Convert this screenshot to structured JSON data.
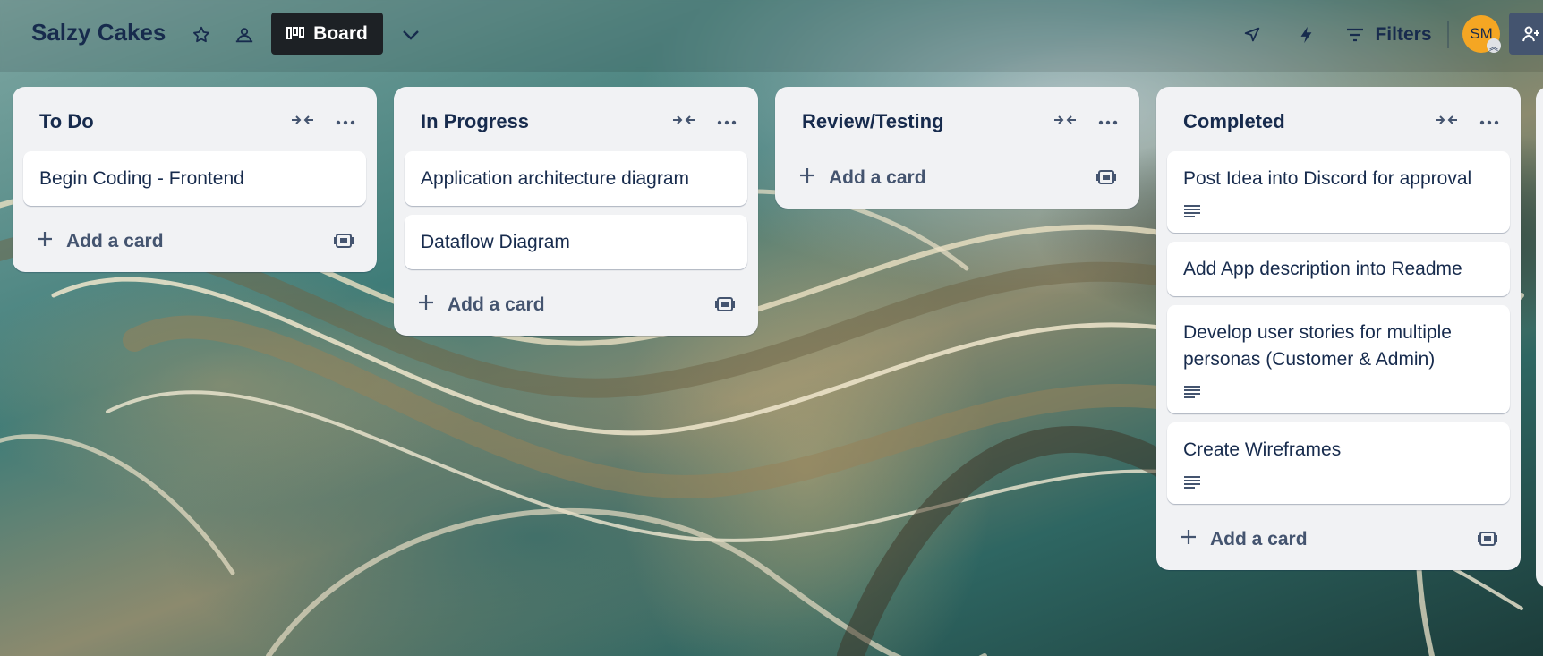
{
  "header": {
    "board_title": "Salzy Cakes",
    "view_label": "Board",
    "filters_label": "Filters",
    "avatar_initials": "SM",
    "icons": {
      "star": "star-icon",
      "visibility": "workspace-visible-icon",
      "board_view": "board-view-icon",
      "view_switch": "chevron-down-icon",
      "power_ups": "rocket-icon",
      "automation": "lightning-icon",
      "filter": "filter-icon",
      "share": "add-member-icon"
    }
  },
  "add_card_label": "Add a card",
  "lists": [
    {
      "title": "To Do",
      "cards": [
        {
          "title": "Begin Coding - Frontend",
          "has_description": false
        }
      ]
    },
    {
      "title": "In Progress",
      "cards": [
        {
          "title": "Application architecture diagram",
          "has_description": false
        },
        {
          "title": "Dataflow Diagram",
          "has_description": false
        }
      ]
    },
    {
      "title": "Review/Testing",
      "cards": []
    },
    {
      "title": "Completed",
      "cards": [
        {
          "title": "Post Idea into Discord for approval",
          "has_description": true
        },
        {
          "title": "Add App description into Readme",
          "has_description": false
        },
        {
          "title": "Develop user stories for multiple personas (Customer & Admin)",
          "has_description": true
        },
        {
          "title": "Create Wireframes",
          "has_description": true
        }
      ]
    }
  ],
  "colors": {
    "list_bg": "#f1f2f4",
    "card_bg": "#ffffff",
    "text": "#172b4d",
    "board_button_bg": "#1d2125",
    "avatar_bg": "#f5a623",
    "share_bg": "#44546f"
  }
}
